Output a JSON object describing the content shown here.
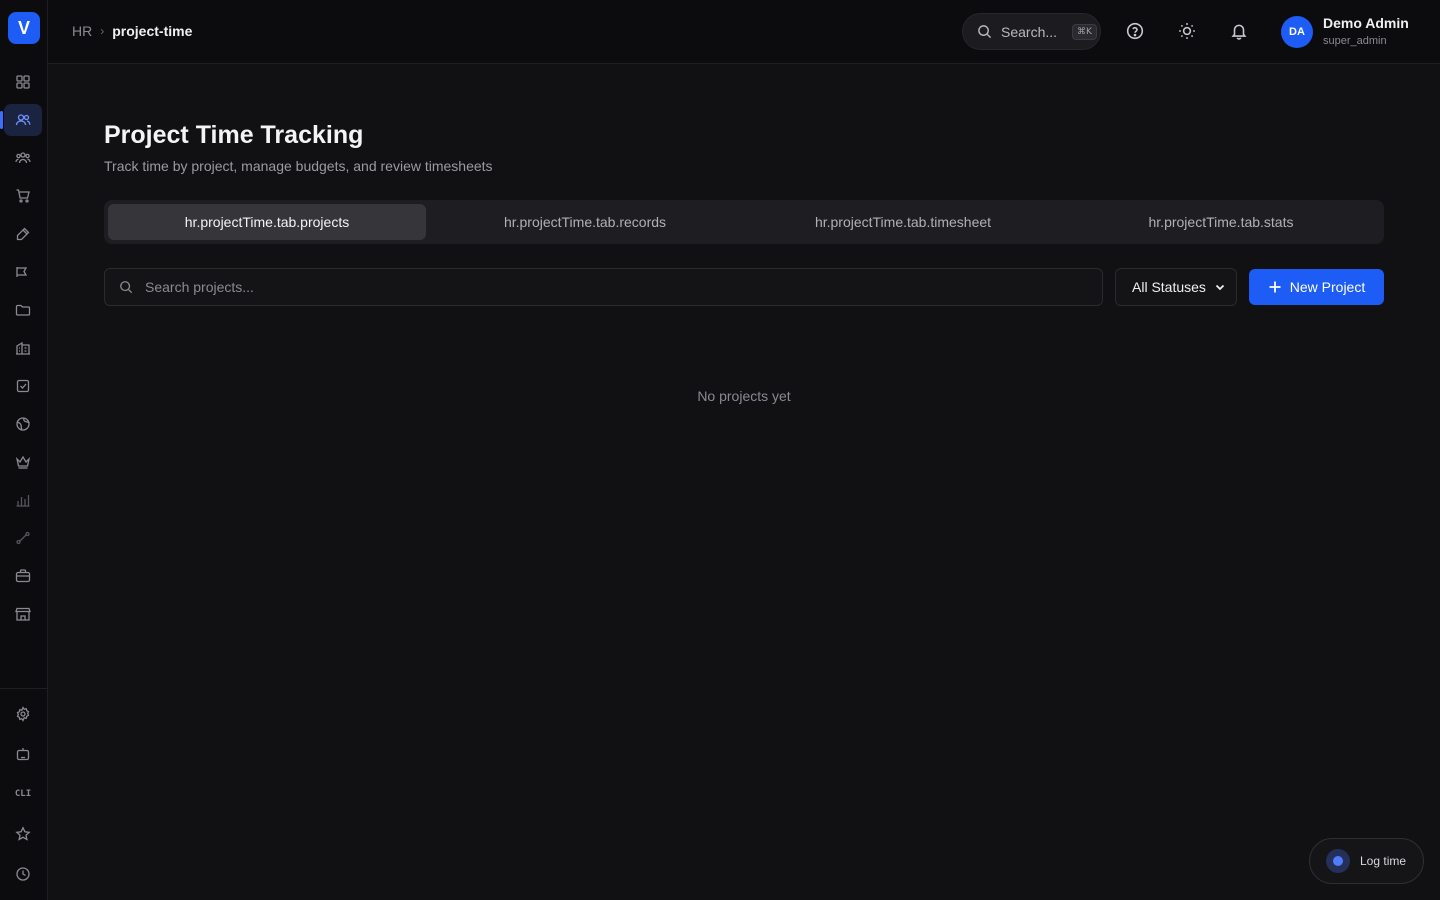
{
  "app": {
    "logo_letter": "V"
  },
  "breadcrumb": {
    "root": "HR",
    "separator": "›",
    "current": "project-time"
  },
  "header": {
    "search_label": "Search...",
    "search_shortcut": "⌘K",
    "user": {
      "initials": "DA",
      "name": "Demo Admin",
      "role": "super_admin"
    }
  },
  "page": {
    "title": "Project Time Tracking",
    "subtitle": "Track time by project, manage budgets, and review timesheets"
  },
  "tabs": [
    {
      "label": "hr.projectTime.tab.projects",
      "active": true
    },
    {
      "label": "hr.projectTime.tab.records",
      "active": false
    },
    {
      "label": "hr.projectTime.tab.timesheet",
      "active": false
    },
    {
      "label": "hr.projectTime.tab.stats",
      "active": false
    }
  ],
  "filters": {
    "search_placeholder": "Search projects...",
    "status_selected": "All Statuses"
  },
  "actions": {
    "new_project_label": "New Project"
  },
  "empty_state": "No projects yet",
  "floating": {
    "log_time_label": "Log time"
  },
  "sidebar": {
    "cli_label": "CLI",
    "icons": [
      "dashboard-icon",
      "users-icon",
      "team-icon",
      "cart-icon",
      "pen-icon",
      "megaphone-icon",
      "folder-icon",
      "building-icon",
      "checkbox-icon",
      "globe-icon",
      "crown-icon",
      "bar-chart-icon",
      "route-icon",
      "briefcase-icon",
      "store-icon",
      "settings-icon",
      "bot-icon",
      "cli-icon",
      "star-icon",
      "clock-icon"
    ]
  },
  "colors": {
    "accent": "#1d5cf5",
    "background": "#111113",
    "sidebar": "#0c0c0e"
  }
}
